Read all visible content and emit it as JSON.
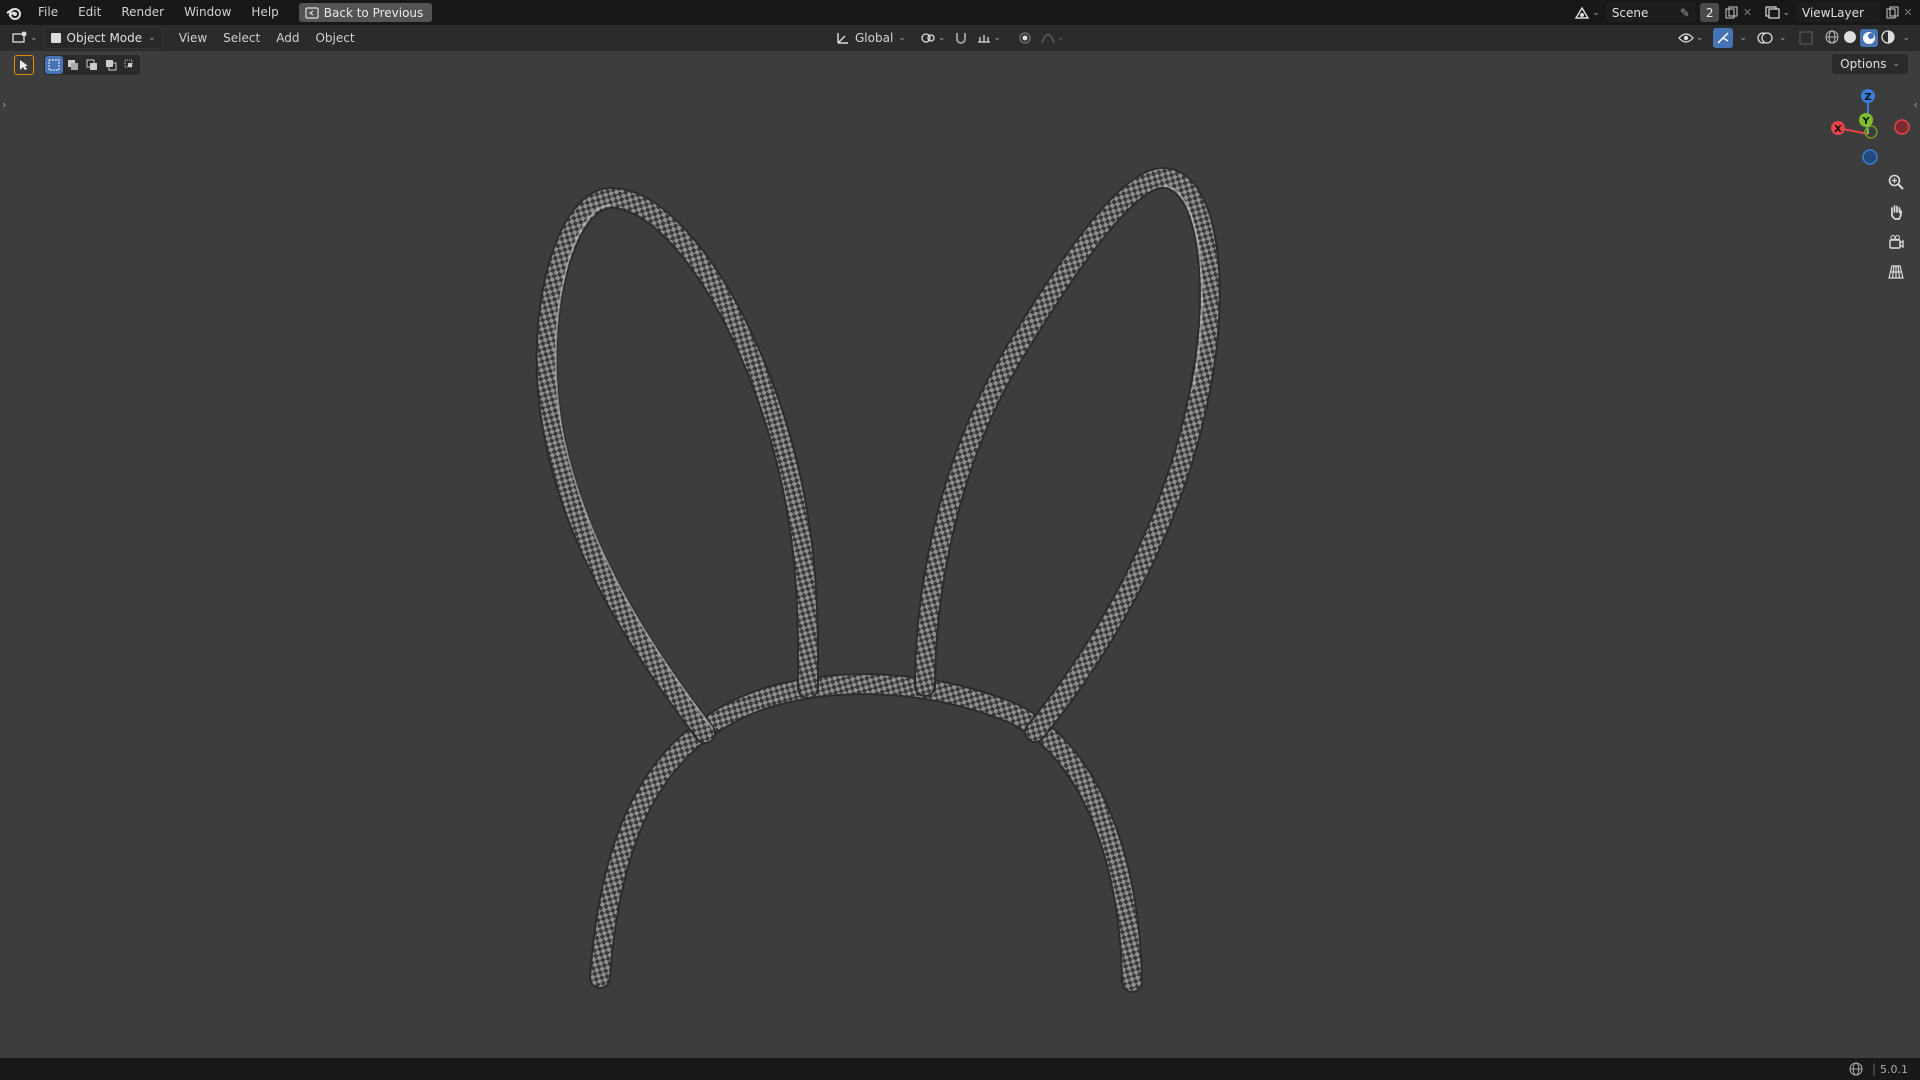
{
  "menu": {
    "items": [
      "File",
      "Edit",
      "Render",
      "Window",
      "Help"
    ],
    "back_button": "Back to Previous"
  },
  "workspace": {
    "scene_label": "Scene",
    "scene_users": "2",
    "view_layer_label": "ViewLayer"
  },
  "viewport_header": {
    "mode": "Object Mode",
    "menus": [
      "View",
      "Select",
      "Add",
      "Object"
    ],
    "transform_orientation": "Global",
    "options_label": "Options"
  },
  "gizmo": {
    "axis_x": "X",
    "axis_y": "Y",
    "axis_z": "Z",
    "colors": {
      "x": "#e8424b",
      "y": "#7fbf2b",
      "z": "#3b7ed8"
    }
  },
  "status": {
    "version": "5.0.1"
  },
  "colors": {
    "viewport_bg": "#3d3d3d",
    "topbar_bg": "#181818",
    "accent": "#4772b3"
  }
}
